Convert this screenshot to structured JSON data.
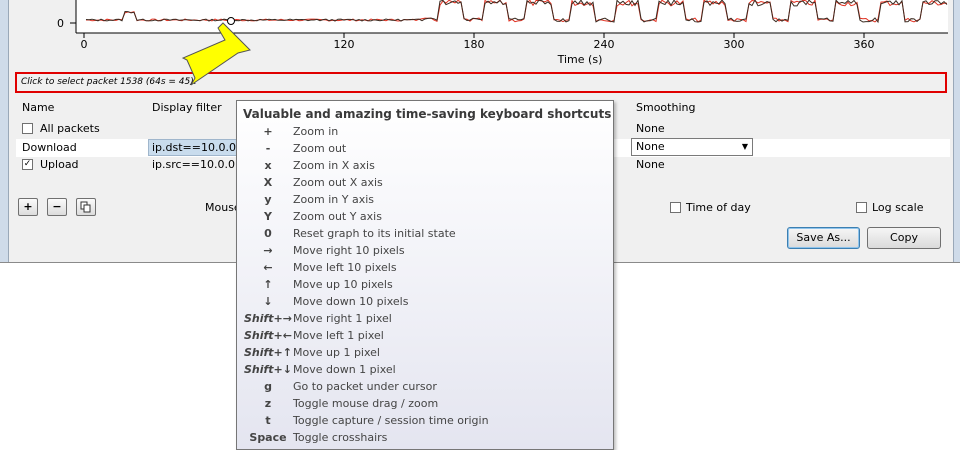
{
  "graph": {
    "y_tick": "0",
    "x_ticks": [
      "0",
      "120",
      "180",
      "240",
      "300",
      "360"
    ],
    "x_label": "Time (s)"
  },
  "status": {
    "text": "Click to select packet 1538 (64s = 45)."
  },
  "table": {
    "headers": {
      "name": "Name",
      "filter": "Display filter",
      "smoothing": "Smoothing"
    },
    "rows": [
      {
        "name": "All packets",
        "checked": false,
        "filter": "",
        "smoothing": "None"
      },
      {
        "name": "Download",
        "checked": null,
        "filter": "ip.dst==10.0.0.1",
        "smoothing": "None"
      },
      {
        "name": "Upload",
        "checked": true,
        "filter": "ip.src==10.0.0.10",
        "smoothing": "None"
      }
    ]
  },
  "controls": {
    "add_label": "+",
    "remove_label": "−",
    "copy_graph_icon": "copy-icon",
    "mouse_label": "Mouse",
    "time_of_day": "Time of day",
    "log_scale": "Log scale",
    "save_as": "Save As...",
    "copy": "Copy",
    "check_mark": "✓",
    "combo_arrow": "▼"
  },
  "tooltip": {
    "title": "Valuable and amazing time-saving keyboard shortcuts",
    "shortcuts": [
      {
        "key": "+",
        "desc": "Zoom in"
      },
      {
        "key": "-",
        "desc": "Zoom out"
      },
      {
        "key": "x",
        "desc": "Zoom in X axis"
      },
      {
        "key": "X",
        "desc": "Zoom out X axis"
      },
      {
        "key": "y",
        "desc": "Zoom in Y axis"
      },
      {
        "key": "Y",
        "desc": "Zoom out Y axis"
      },
      {
        "key": "0",
        "desc": "Reset graph to its initial state"
      },
      {
        "key": "→",
        "desc": "Move right 10 pixels"
      },
      {
        "key": "←",
        "desc": "Move left 10 pixels"
      },
      {
        "key": "↑",
        "desc": "Move up 10 pixels"
      },
      {
        "key": "↓",
        "desc": "Move down 10 pixels"
      },
      {
        "key": "Shift+→",
        "desc": "Move right 1 pixel"
      },
      {
        "key": "Shift+←",
        "desc": "Move left 1 pixel"
      },
      {
        "key": "Shift+↑",
        "desc": "Move up 1 pixel"
      },
      {
        "key": "Shift+↓",
        "desc": "Move down 1 pixel"
      },
      {
        "key": "g",
        "desc": "Go to packet under cursor"
      },
      {
        "key": "z",
        "desc": "Toggle mouse drag / zoom"
      },
      {
        "key": "t",
        "desc": "Toggle capture / session time origin"
      },
      {
        "key": "Space",
        "desc": "Toggle crosshairs"
      }
    ]
  },
  "colors": {
    "accent_red": "#e00000",
    "arrow_yellow": "#ffff00",
    "series_dark": "#3a2a20",
    "series_red": "#e03020"
  }
}
